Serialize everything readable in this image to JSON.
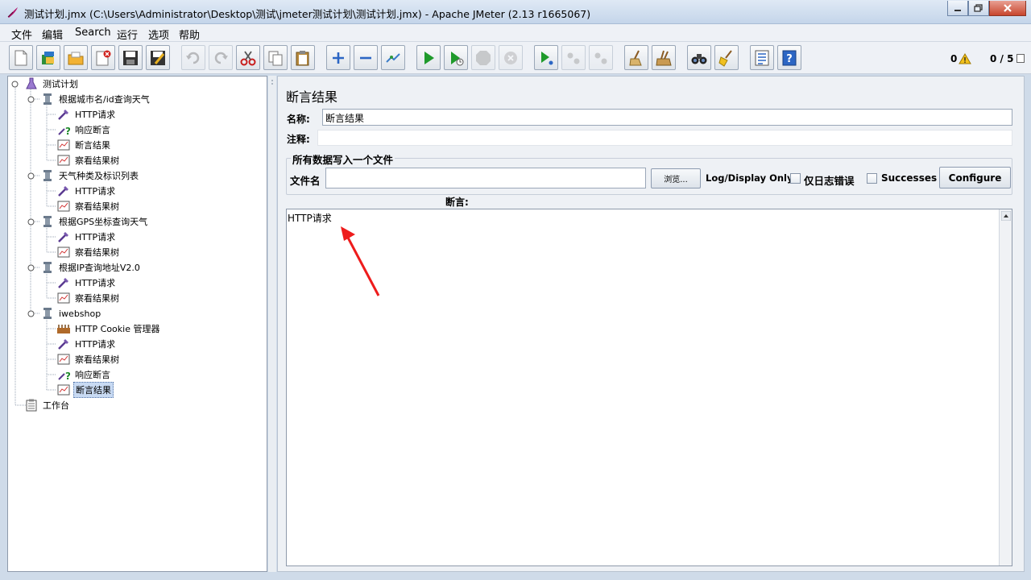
{
  "window": {
    "title": "测试计划.jmx (C:\\Users\\Administrator\\Desktop\\测试\\jmeter测试计划\\测试计划.jmx) - Apache JMeter (2.13 r1665067)"
  },
  "menu": [
    "文件",
    "编辑",
    "Search",
    "运行",
    "选项",
    "帮助"
  ],
  "status": {
    "warnings": "0",
    "threads": "0 / 5"
  },
  "tree": {
    "root": "测试计划",
    "groups": [
      {
        "label": "根据城市名/id查询天气",
        "children": [
          "HTTP请求",
          "响应断言",
          "断言结果",
          "察看结果树"
        ]
      },
      {
        "label": "天气种类及标识列表",
        "children": [
          "HTTP请求",
          "察看结果树"
        ]
      },
      {
        "label": "根据GPS坐标查询天气",
        "children": [
          "HTTP请求",
          "察看结果树"
        ]
      },
      {
        "label": "根据IP查询地址V2.0",
        "children": [
          "HTTP请求",
          "察看结果树"
        ]
      },
      {
        "label": "iwebshop",
        "children": [
          "HTTP Cookie 管理器",
          "HTTP请求",
          "察看结果树",
          "响应断言",
          "断言结果"
        ]
      }
    ],
    "workbench": "工作台"
  },
  "panel": {
    "title": "断言结果",
    "name_label": "名称:",
    "name_value": "断言结果",
    "comment_label": "注释:",
    "comment_value": "",
    "file_group_title": "所有数据写入一个文件",
    "filename_label": "文件名",
    "filename_value": "",
    "browse_button": "浏览...",
    "log_display_label": "Log/Display Only:",
    "errors_only_label": "仅日志错误",
    "successes_label": "Successes",
    "configure_button": "Configure",
    "assertions_label": "断言:",
    "assertions_text": "HTTP请求"
  }
}
